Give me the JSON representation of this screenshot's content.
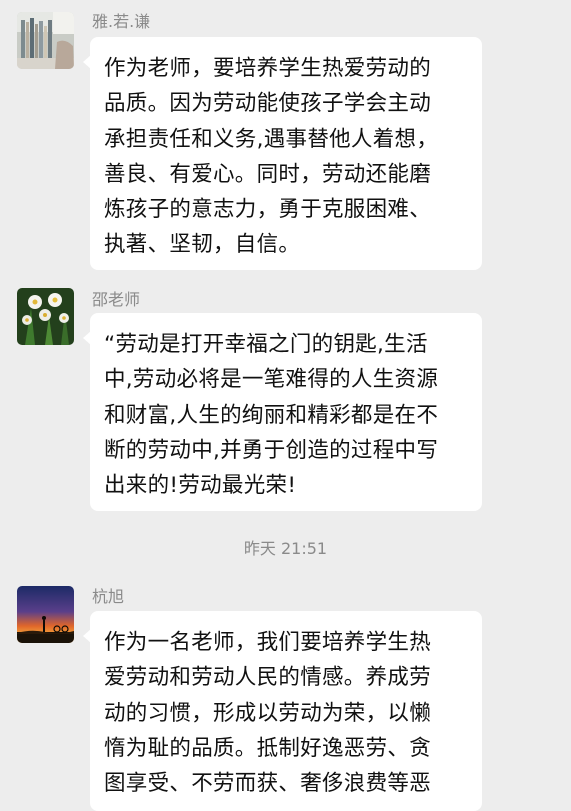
{
  "messages": [
    {
      "sender": "雅.若.谦",
      "avatar": "bookshelf-avatar",
      "lines": [
        "作为老师，要培养学生热爱劳动的",
        "品质。因为劳动能使孩子学会主动",
        "承担责任和义务,遇事替他人着想，",
        "善良、有爱心。同时，劳动还能磨",
        "炼孩子的意志力，勇于克服困难、",
        "执著、坚韧，自信。"
      ]
    },
    {
      "sender": "邵老师",
      "avatar": "narcissus-flower-avatar",
      "lines": [
        "“劳动是打开幸福之门的钥匙,生活",
        "中,劳动必将是一笔难得的人生资源",
        "和财富,人生的绚丽和精彩都是在不",
        "断的劳动中,并勇于创造的过程中写",
        "出来的!劳动最光荣!"
      ]
    },
    {
      "sender": "杭旭",
      "avatar": "sunset-silhouette-avatar",
      "lines": [
        "作为一名老师，我们要培养学生热",
        "爱劳动和劳动人民的情感。养成劳",
        "动的习惯，形成以劳动为荣，以懒",
        "惰为耻的品质。抵制好逸恶劳、贪",
        "图享受、不劳而获、奢侈浪费等恶"
      ]
    }
  ],
  "timestamp": "昨天 21:51"
}
